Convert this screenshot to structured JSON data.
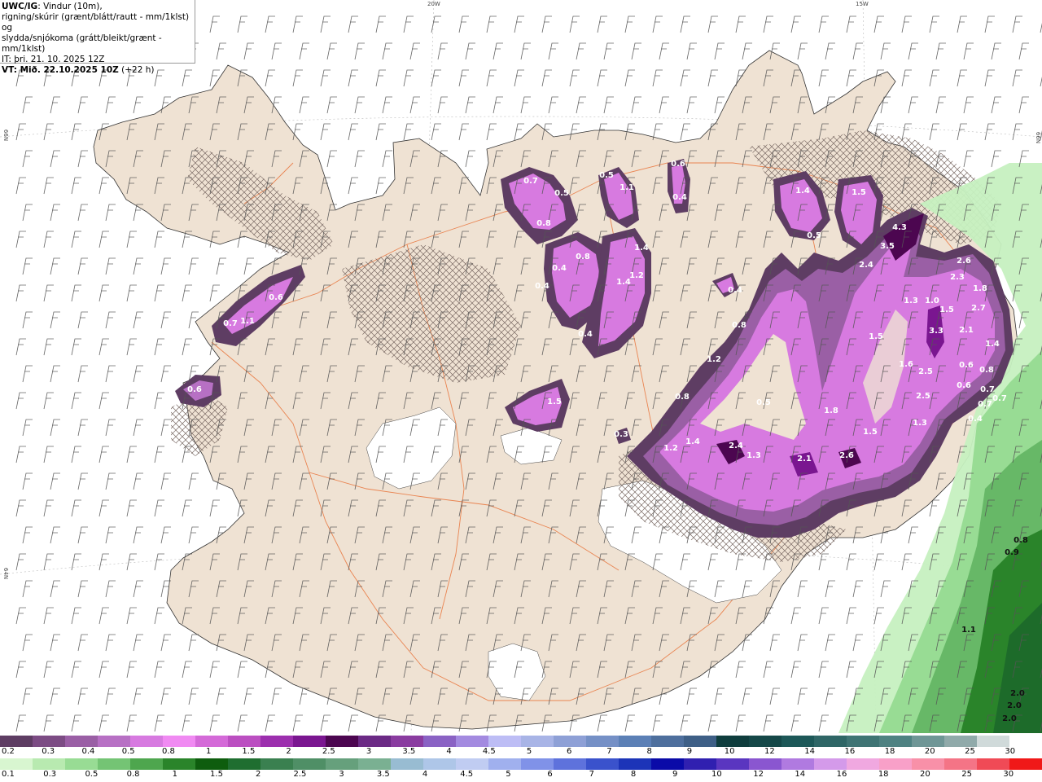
{
  "info": {
    "model": "UWC/IG",
    "line1_rest": ": Vindur (10m),",
    "line2": "rigning/skúrir (grænt/blátt/rautt - mm/1klst) og",
    "line3": "slydda/snjókoma (grátt/bleikt/grænt - mm/1klst)",
    "line4": "IT: þri. 21. 10. 2025 12Z",
    "line5_bold": "VT: Mið. 22.10.2025 10Z",
    "line5_rest": " (+22 h)"
  },
  "grid_labels": {
    "lon20": "20W",
    "lon15": "15W",
    "lat66_left": "66N",
    "lat66_right": "66N",
    "lat64": "64N"
  },
  "colors": {
    "land": "#efe2d3",
    "roads": "#e8743b",
    "glacier": "#ffffff",
    "snow_light": "#c98ae0",
    "snow_mid": "#d36bd6",
    "snow_strong": "#9c2fae",
    "snow_dark": "#5e2a62",
    "rain_light": "#c6f0c0",
    "rain_mid": "#67b867",
    "rain_dark": "#1d6b2a"
  },
  "precip_values": [
    {
      "v": "0.7"
    },
    {
      "v": "0.5"
    },
    {
      "v": "0.8"
    },
    {
      "v": "0.5"
    },
    {
      "v": "1.1"
    },
    {
      "v": "0.6"
    },
    {
      "v": "0.4"
    },
    {
      "v": "1.4"
    },
    {
      "v": "1.5"
    },
    {
      "v": "0.5"
    },
    {
      "v": "3.5"
    },
    {
      "v": "4.3"
    },
    {
      "v": "2.4"
    },
    {
      "v": "2.6"
    },
    {
      "v": "2.3"
    },
    {
      "v": "1.8"
    },
    {
      "v": "2.7"
    },
    {
      "v": "1.3"
    },
    {
      "v": "1.0"
    },
    {
      "v": "1.5"
    },
    {
      "v": "3.3"
    },
    {
      "v": "2.1"
    },
    {
      "v": "1.4"
    },
    {
      "v": "0.4"
    },
    {
      "v": "0.8"
    },
    {
      "v": "1.4"
    },
    {
      "v": "1.2"
    },
    {
      "v": "1.4"
    },
    {
      "v": "0.4"
    },
    {
      "v": "0.4"
    },
    {
      "v": "0.4"
    },
    {
      "v": "0.8"
    },
    {
      "v": "1.2"
    },
    {
      "v": "0.8"
    },
    {
      "v": "0.5"
    },
    {
      "v": "1.5"
    },
    {
      "v": "1.6"
    },
    {
      "v": "2.5"
    },
    {
      "v": "2.5"
    },
    {
      "v": "0.6"
    },
    {
      "v": "0.8"
    },
    {
      "v": "0.6"
    },
    {
      "v": "0.7"
    },
    {
      "v": "0.4"
    },
    {
      "v": "1.3"
    },
    {
      "v": "1.5"
    },
    {
      "v": "1.8"
    },
    {
      "v": "1.2"
    },
    {
      "v": "1.4"
    },
    {
      "v": "2.4"
    },
    {
      "v": "1.3"
    },
    {
      "v": "2.1"
    },
    {
      "v": "2.6"
    },
    {
      "v": "0.3"
    },
    {
      "v": "1.5"
    },
    {
      "v": "0.6"
    },
    {
      "v": "0.7"
    },
    {
      "v": "1.1"
    },
    {
      "v": "0.6"
    },
    {
      "v": "0.7"
    },
    {
      "v": "0.7"
    },
    {
      "v": "0.8"
    },
    {
      "v": "0.9"
    },
    {
      "v": "1.1"
    },
    {
      "v": "2.0"
    },
    {
      "v": "2.0"
    },
    {
      "v": "2.0"
    }
  ],
  "legend_snow": {
    "colors": [
      "#5e3d63",
      "#7c4c84",
      "#9a5fa5",
      "#b770c4",
      "#d77ae0",
      "#f08af2",
      "#d46ad8",
      "#bb4fc1",
      "#9c2fae",
      "#7a1690",
      "#4c0650",
      "#6b2a85",
      "#8a3ca0",
      "#8a62c4",
      "#a38ae0",
      "#bdbdf5",
      "#a8b4e6",
      "#8ea0d6",
      "#7590c6",
      "#5c80b6",
      "#4e6f9d",
      "#3e5f86",
      "#0f3d3d",
      "#154848",
      "#1d5858",
      "#2f6666",
      "#3f7474",
      "#4f8282",
      "#6f9696",
      "#90aaaa",
      "#d0dada",
      "#ffffff"
    ],
    "labels": [
      "0.2",
      "0.3",
      "0.4",
      "0.5",
      "0.8",
      "1",
      "1.5",
      "2",
      "2.5",
      "3",
      "3.5",
      "4",
      "4.5",
      "5",
      "6",
      "7",
      "8",
      "9",
      "10",
      "12",
      "14",
      "16",
      "18",
      "20",
      "25",
      "30"
    ]
  },
  "legend_rain": {
    "colors": [
      "#d8f6d0",
      "#b8eab0",
      "#98dc94",
      "#74c474",
      "#4ea64e",
      "#2a842a",
      "#0e5d0e",
      "#1f6e30",
      "#3a8050",
      "#4f8f66",
      "#66a07c",
      "#7ab092",
      "#98bcd2",
      "#aec6e8",
      "#c0ccf2",
      "#a0b0ee",
      "#8092e8",
      "#5e72dc",
      "#3a52cc",
      "#1c34b8",
      "#0a0aa8",
      "#3020b0",
      "#5a36c0",
      "#8a56d0",
      "#b07ae0",
      "#d49aea",
      "#f0a8e0",
      "#f8a0c8",
      "#f890a8",
      "#f47486",
      "#f04a56",
      "#f01818"
    ],
    "labels": [
      "0.1",
      "0.3",
      "0.5",
      "0.8",
      "1",
      "1.5",
      "2",
      "2.5",
      "3",
      "3.5",
      "4",
      "4.5",
      "5",
      "6",
      "7",
      "8",
      "9",
      "10",
      "12",
      "14",
      "16",
      "18",
      "20",
      "25",
      "30"
    ]
  }
}
